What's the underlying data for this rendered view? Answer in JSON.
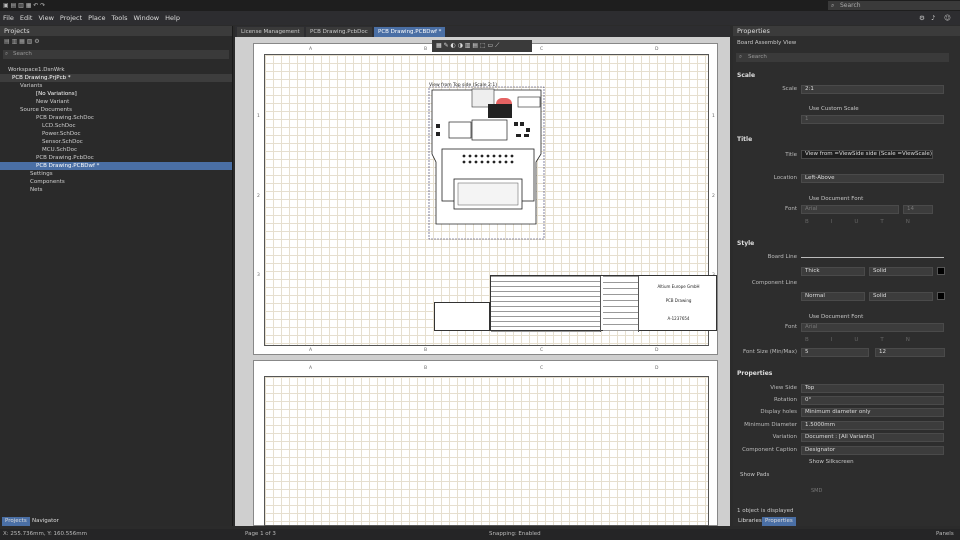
{
  "topbar": {
    "search": "Search"
  },
  "menu": [
    "File",
    "Edit",
    "View",
    "Project",
    "Place",
    "Tools",
    "Window",
    "Help"
  ],
  "projects": {
    "title": "Projects",
    "search": "Search",
    "tree": [
      "Workspace1.DsnWrk",
      "PCB Drawing.PrjPcb *",
      "Variants",
      "[No Variations]",
      "New Variant",
      "Source Documents",
      "PCB Drawing.SchDoc",
      "LCD.SchDoc",
      "Power.SchDoc",
      "Sensor.SchDoc",
      "MCU.SchDoc",
      "PCB Drawing.PcbDoc",
      "PCB Drawing.PCBDwf *",
      "Settings",
      "Components",
      "Nets"
    ]
  },
  "tabs": [
    "License Management",
    "PCB Drawing.PcbDoc",
    "PCB Drawing.PCBDwf *"
  ],
  "drawing": {
    "cols": [
      "A",
      "B",
      "C",
      "D"
    ],
    "rows": [
      "1",
      "2",
      "3"
    ],
    "view_label": "View from Top side (Scale 2:1)",
    "company": "Altium Europe GmbH",
    "doc_title": "PCB Drawing",
    "doc_no": "A-1237654"
  },
  "props": {
    "title": "Properties",
    "subtitle": "Board Assembly View",
    "search": "Search",
    "scale_sec": "Scale",
    "scale_lbl": "Scale",
    "scale_val": "2:1",
    "custom_scale": "Use Custom Scale",
    "custom_val": "1",
    "title_sec": "Title",
    "title_lbl": "Title",
    "title_val": "View from =ViewSide side (Scale =ViewScale)",
    "loc_lbl": "Location",
    "loc_val": "Left-Above",
    "docfont": "Use Document Font",
    "font_lbl": "Font",
    "font_val": "Arial",
    "font_size": "14",
    "style_sec": "Style",
    "board_line": "Board Line",
    "comp_line": "Component Line",
    "thick": "Thick",
    "solid": "Solid",
    "normal": "Normal",
    "docfont2": "Use Document Font",
    "font2_lbl": "Font",
    "font2_val": "Arial",
    "fsize_lbl": "Font Size (Min/Max)",
    "fmin": "5",
    "fmax": "12",
    "props_sec": "Properties",
    "view_side_lbl": "View Side",
    "view_side": "Top",
    "rot_lbl": "Rotation",
    "rot": "0°",
    "holes_lbl": "Display holes",
    "holes": "Minimum diameter only",
    "mindia_lbl": "Minimum Diameter",
    "mindia": "1.5000mm",
    "var_lbl": "Variation",
    "var": "Document : [All Variants]",
    "cap_lbl": "Component Caption",
    "cap": "Designator",
    "silk": "Show Silkscreen",
    "pads": "Show Pads",
    "pads_val": "SMD",
    "selected": "1 object is displayed"
  },
  "bottom_tabs": {
    "projects": "Projects",
    "navigator": "Navigator",
    "libraries": "Libraries",
    "properties": "Properties"
  },
  "status": {
    "coords": "X: 255.736mm, Y: 160.556mm",
    "page": "Page 1 of 3",
    "snap": "Snapping: Enabled",
    "panels": "Panels"
  }
}
